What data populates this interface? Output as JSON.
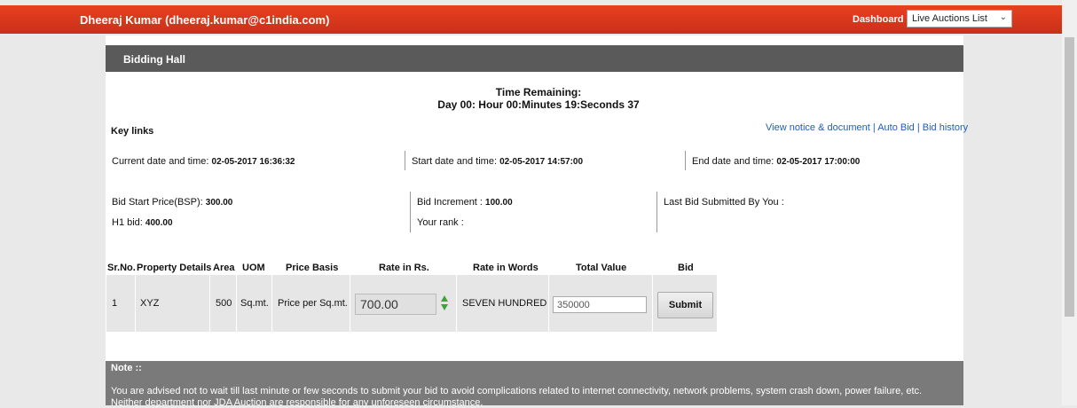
{
  "header": {
    "user": "Dheeraj Kumar (dheeraj.kumar@c1india.com)",
    "dashboard_link": "Dashboard",
    "select_value": "Live Auctions List"
  },
  "hall": {
    "title": "Bidding Hall"
  },
  "timer": {
    "label": "Time Remaining:",
    "value": "Day 00: Hour 00:Minutes 19:Seconds 37"
  },
  "keylinks": {
    "title": "Key links",
    "link1": "View notice & document",
    "link2": "Auto Bid",
    "link3": "Bid history",
    "sep": " | "
  },
  "dates": {
    "current_label": "Current date and time:",
    "current_value": "02-05-2017 16:36:32",
    "start_label": "Start date and time:",
    "start_value": "02-05-2017 14:57:00",
    "end_label": "End date and time:",
    "end_value": "02-05-2017 17:00:00"
  },
  "bid_info": {
    "bsp_label": "Bid Start Price(BSP):",
    "bsp_value": "300.00",
    "increment_label": "Bid Increment :",
    "increment_value": "100.00",
    "last_bid_label": "Last Bid Submitted By You :",
    "h1_label": "H1 bid:",
    "h1_value": "400.00",
    "rank_label": "Your rank :"
  },
  "table": {
    "headers": [
      "Sr.No.",
      "Property Details",
      "Area",
      "UOM",
      "Price Basis",
      "Rate in Rs.",
      "Rate in Words",
      "Total Value",
      "Bid"
    ],
    "row": {
      "srno": "1",
      "property": "XYZ",
      "area": "500",
      "uom": "Sq.mt.",
      "price_basis": "Price per Sq.mt.",
      "rate": "700.00",
      "rate_words": "SEVEN HUNDRED",
      "total_value": "350000",
      "submit_label": "Submit"
    }
  },
  "note": {
    "title": "Note ::",
    "line1": "You are advised not to wait till last minute or few seconds to submit your bid to avoid complications related to internet connectivity, network problems, system crash down, power failure, etc.",
    "line2": "Neither department nor JDA Auction are responsible for any unforeseen circumstance."
  },
  "colors": {
    "topbar": "#d9381e",
    "hall_bar": "#5a5a5a",
    "note_bg": "#7a7a7a",
    "link": "#1f5fb5",
    "spinner": "#3aa53a"
  }
}
